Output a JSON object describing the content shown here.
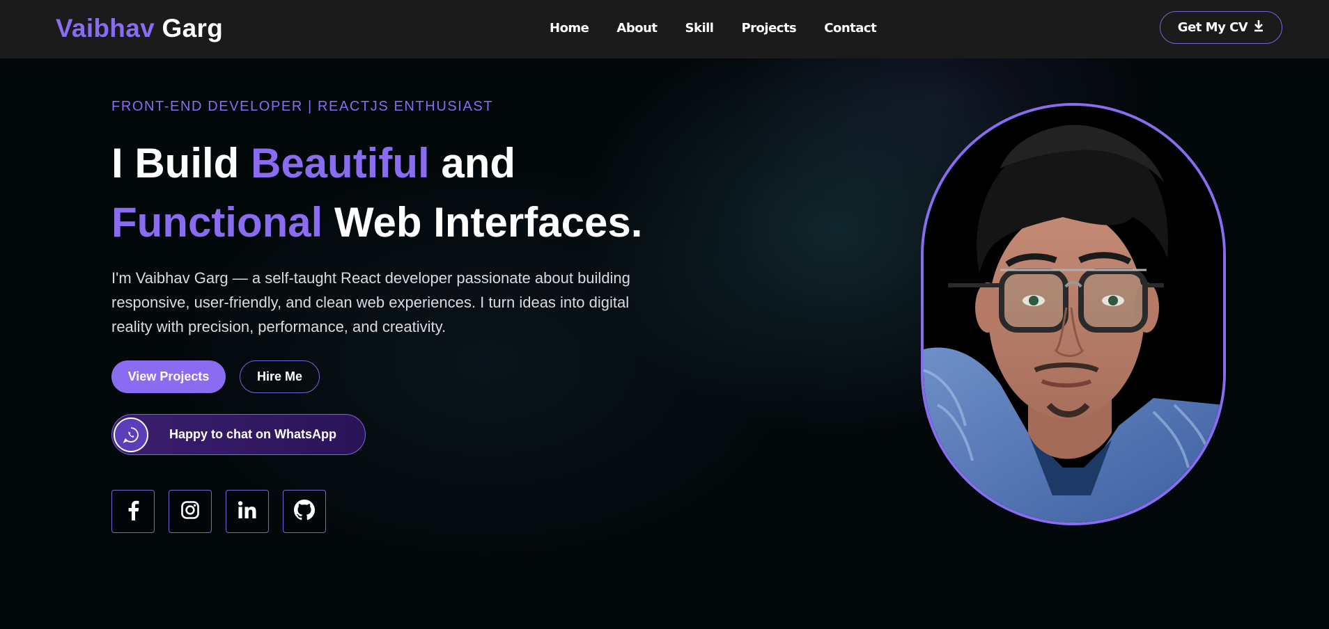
{
  "nav": {
    "logo_first": "Vaibhav",
    "logo_last": "Garg",
    "items": [
      {
        "label": "Home"
      },
      {
        "label": "About"
      },
      {
        "label": "Skill"
      },
      {
        "label": "Projects"
      },
      {
        "label": "Contact"
      }
    ],
    "cv_label": "Get My CV",
    "cv_icon": "download-icon"
  },
  "hero": {
    "tagline": "FRONT-END DEVELOPER | REACTJS ENTHUSIAST",
    "headline": {
      "part1": "I Build ",
      "accent1": "Beautiful",
      "part2": " and",
      "accent2": "Functional",
      "part3": " Web Interfaces."
    },
    "description": "I'm Vaibhav Garg — a self-taught React developer passionate about building responsive, user-friendly, and clean web experiences. I turn ideas into digital reality with precision, performance, and creativity.",
    "primary_button": "View Projects",
    "secondary_button": "Hire Me",
    "whatsapp_label": "Happy to chat on WhatsApp",
    "whatsapp_icon": "whatsapp-icon",
    "socials": [
      {
        "icon": "facebook-icon"
      },
      {
        "icon": "instagram-icon"
      },
      {
        "icon": "linkedin-icon"
      },
      {
        "icon": "github-icon"
      }
    ]
  },
  "colors": {
    "accent": "#8a6cf0",
    "nav_bg": "#1b1b1b",
    "page_bg": "#03080b",
    "text": "#ffffff"
  }
}
